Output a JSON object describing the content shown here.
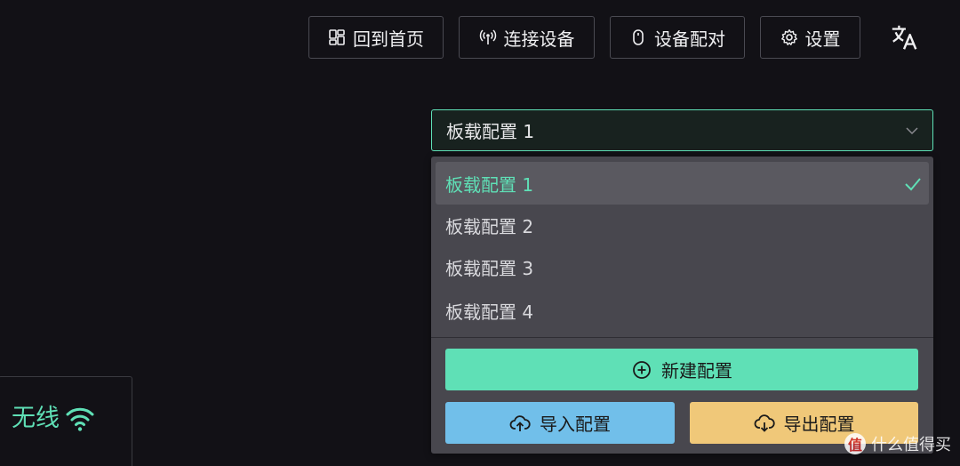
{
  "nav": {
    "home": "回到首页",
    "connect": "连接设备",
    "pair": "设备配对",
    "settings": "设置",
    "language_icon": "translate-icon"
  },
  "profile_select": {
    "value": "板载配置 1",
    "options": [
      {
        "label": "板载配置 1",
        "selected": true
      },
      {
        "label": "板载配置 2",
        "selected": false
      },
      {
        "label": "板载配置 3",
        "selected": false
      },
      {
        "label": "板载配置 4",
        "selected": false
      }
    ],
    "actions": {
      "new": "新建配置",
      "import": "导入配置",
      "export": "导出配置"
    }
  },
  "connection": {
    "mode": "无线",
    "icon": "wifi-icon"
  },
  "watermark": {
    "badge": "值",
    "text": "什么值得买"
  },
  "colors": {
    "background": "#121116",
    "accent": "#5fe0b6",
    "dropdown": "#48474e",
    "import": "#71bfea",
    "export": "#f0c879"
  }
}
